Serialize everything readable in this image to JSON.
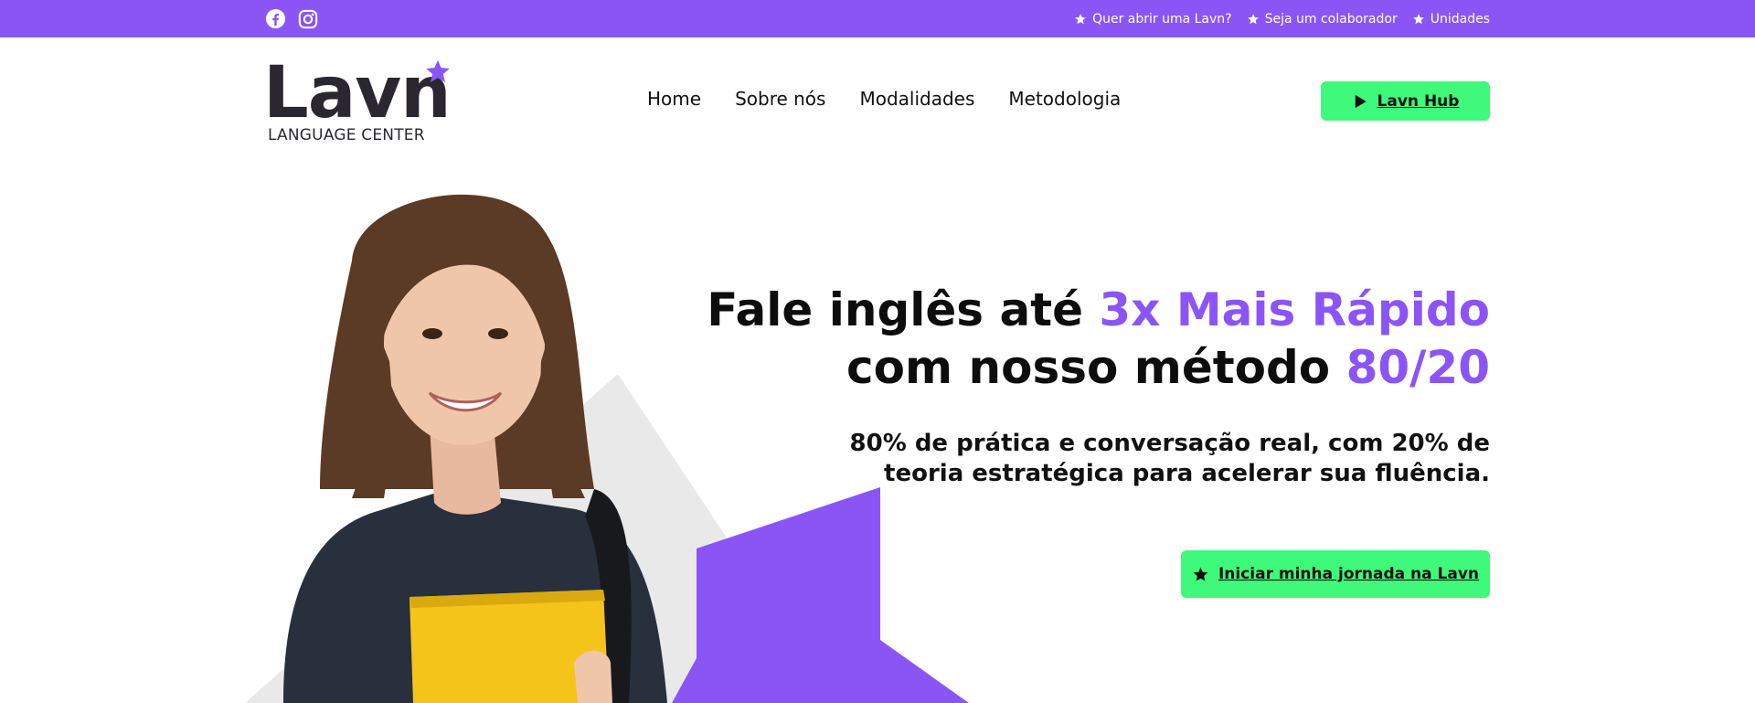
{
  "topbar": {
    "bg_color": "#8b55f5",
    "social": [
      {
        "name": "facebook-icon"
      },
      {
        "name": "instagram-icon"
      }
    ],
    "links": [
      {
        "label": "Quer abrir uma Lavn?",
        "icon": "star-icon"
      },
      {
        "label": "Seja um colaborador",
        "icon": "star-icon"
      },
      {
        "label": "Unidades",
        "icon": "star-icon"
      }
    ]
  },
  "header": {
    "logo": {
      "word": "Lavn",
      "sub": "LANGUAGE CENTER"
    },
    "nav": [
      "Home",
      "Sobre nós",
      "Modalidades",
      "Metodologia"
    ],
    "hub_button": {
      "label": "Lavn Hub",
      "icon": "play-icon",
      "color": "#3ef97a"
    }
  },
  "hero": {
    "headline_line1_plain": "Fale inglês até ",
    "headline_line1_accent": "3x Mais Rápido",
    "headline_line2_plain": "com nosso método ",
    "headline_line2_accent": "80/20",
    "sub_line1": "80% de prática e conversação real, com 20% de",
    "sub_line2": "teoria estratégica para acelerar sua fluência.",
    "cta_label": "Iniciar minha jornada na Lavn",
    "accent_color": "#8b55f5",
    "cta_color": "#3ef97a"
  }
}
